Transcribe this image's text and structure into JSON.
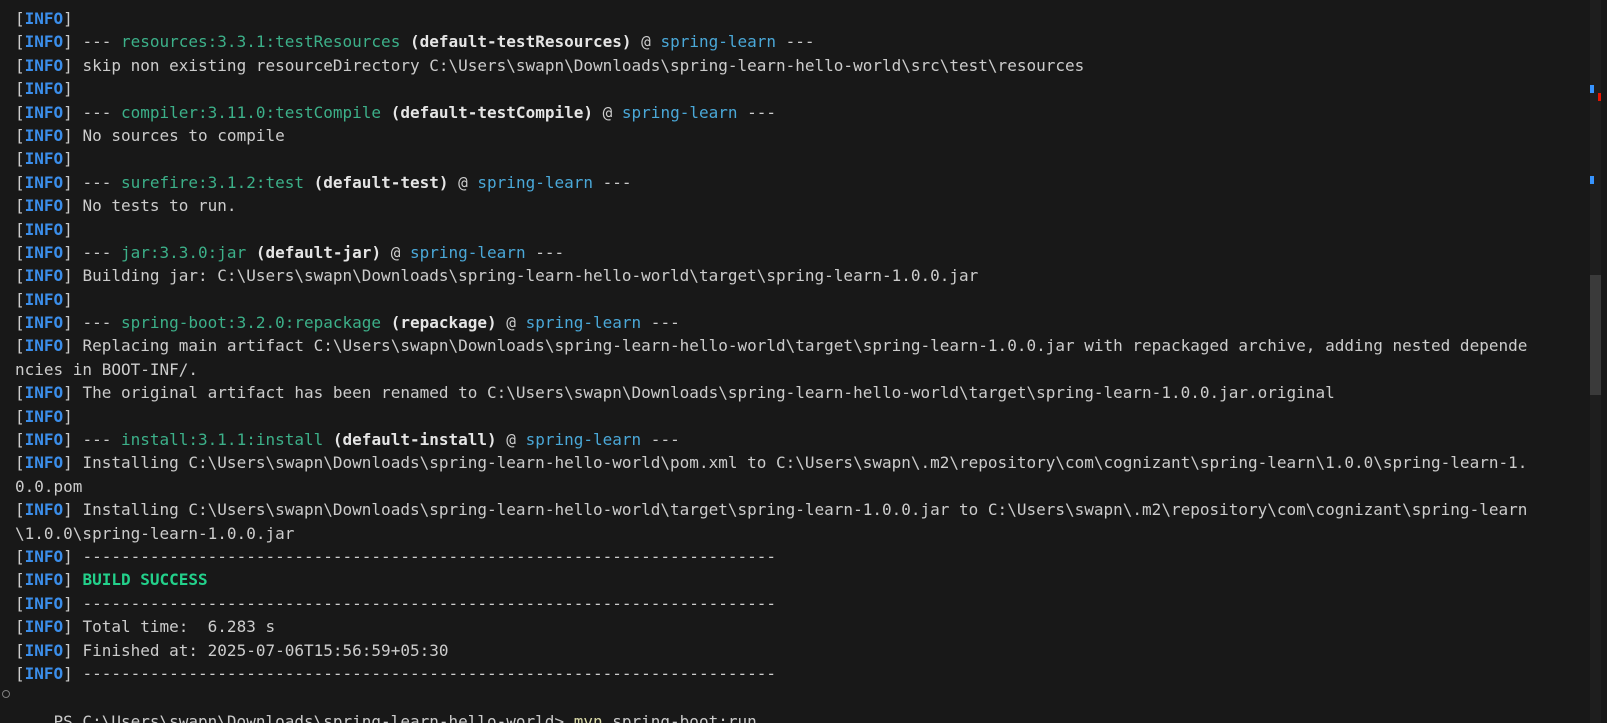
{
  "colors": {
    "background": "#181818",
    "text": "#cccccc",
    "info_tag": "#3b8eea",
    "success": "#23d18b",
    "plugin": "#3cb089",
    "project": "#4aa8d8",
    "command": "#dcdcaa"
  },
  "terminal": {
    "lines": [
      [
        {
          "c": "br",
          "t": "["
        },
        {
          "c": "tag",
          "t": "INFO"
        },
        {
          "c": "br",
          "t": "]"
        }
      ],
      [
        {
          "c": "br",
          "t": "["
        },
        {
          "c": "tag",
          "t": "INFO"
        },
        {
          "c": "br",
          "t": "] --- "
        },
        {
          "c": "plugin",
          "t": "resources:3.3.1:testResources"
        },
        {
          "c": "br",
          "t": " "
        },
        {
          "c": "bold",
          "t": "(default-testResources)"
        },
        {
          "c": "br",
          "t": " @ "
        },
        {
          "c": "proj",
          "t": "spring-learn"
        },
        {
          "c": "br",
          "t": " ---"
        }
      ],
      [
        {
          "c": "br",
          "t": "["
        },
        {
          "c": "tag",
          "t": "INFO"
        },
        {
          "c": "br",
          "t": "] skip non existing resourceDirectory C:\\Users\\swapn\\Downloads\\spring-learn-hello-world\\src\\test\\resources"
        }
      ],
      [
        {
          "c": "br",
          "t": "["
        },
        {
          "c": "tag",
          "t": "INFO"
        },
        {
          "c": "br",
          "t": "]"
        }
      ],
      [
        {
          "c": "br",
          "t": "["
        },
        {
          "c": "tag",
          "t": "INFO"
        },
        {
          "c": "br",
          "t": "] --- "
        },
        {
          "c": "plugin",
          "t": "compiler:3.11.0:testCompile"
        },
        {
          "c": "br",
          "t": " "
        },
        {
          "c": "bold",
          "t": "(default-testCompile)"
        },
        {
          "c": "br",
          "t": " @ "
        },
        {
          "c": "proj",
          "t": "spring-learn"
        },
        {
          "c": "br",
          "t": " ---"
        }
      ],
      [
        {
          "c": "br",
          "t": "["
        },
        {
          "c": "tag",
          "t": "INFO"
        },
        {
          "c": "br",
          "t": "] No sources to compile"
        }
      ],
      [
        {
          "c": "br",
          "t": "["
        },
        {
          "c": "tag",
          "t": "INFO"
        },
        {
          "c": "br",
          "t": "]"
        }
      ],
      [
        {
          "c": "br",
          "t": "["
        },
        {
          "c": "tag",
          "t": "INFO"
        },
        {
          "c": "br",
          "t": "] --- "
        },
        {
          "c": "plugin",
          "t": "surefire:3.1.2:test"
        },
        {
          "c": "br",
          "t": " "
        },
        {
          "c": "bold",
          "t": "(default-test)"
        },
        {
          "c": "br",
          "t": " @ "
        },
        {
          "c": "proj",
          "t": "spring-learn"
        },
        {
          "c": "br",
          "t": " ---"
        }
      ],
      [
        {
          "c": "br",
          "t": "["
        },
        {
          "c": "tag",
          "t": "INFO"
        },
        {
          "c": "br",
          "t": "] No tests to run."
        }
      ],
      [
        {
          "c": "br",
          "t": "["
        },
        {
          "c": "tag",
          "t": "INFO"
        },
        {
          "c": "br",
          "t": "]"
        }
      ],
      [
        {
          "c": "br",
          "t": "["
        },
        {
          "c": "tag",
          "t": "INFO"
        },
        {
          "c": "br",
          "t": "] --- "
        },
        {
          "c": "plugin",
          "t": "jar:3.3.0:jar"
        },
        {
          "c": "br",
          "t": " "
        },
        {
          "c": "bold",
          "t": "(default-jar)"
        },
        {
          "c": "br",
          "t": " @ "
        },
        {
          "c": "proj",
          "t": "spring-learn"
        },
        {
          "c": "br",
          "t": " ---"
        }
      ],
      [
        {
          "c": "br",
          "t": "["
        },
        {
          "c": "tag",
          "t": "INFO"
        },
        {
          "c": "br",
          "t": "] Building jar: C:\\Users\\swapn\\Downloads\\spring-learn-hello-world\\target\\spring-learn-1.0.0.jar"
        }
      ],
      [
        {
          "c": "br",
          "t": "["
        },
        {
          "c": "tag",
          "t": "INFO"
        },
        {
          "c": "br",
          "t": "]"
        }
      ],
      [
        {
          "c": "br",
          "t": "["
        },
        {
          "c": "tag",
          "t": "INFO"
        },
        {
          "c": "br",
          "t": "] --- "
        },
        {
          "c": "plugin",
          "t": "spring-boot:3.2.0:repackage"
        },
        {
          "c": "br",
          "t": " "
        },
        {
          "c": "bold",
          "t": "(repackage)"
        },
        {
          "c": "br",
          "t": " @ "
        },
        {
          "c": "proj",
          "t": "spring-learn"
        },
        {
          "c": "br",
          "t": " ---"
        }
      ],
      [
        {
          "c": "br",
          "t": "["
        },
        {
          "c": "tag",
          "t": "INFO"
        },
        {
          "c": "br",
          "t": "] Replacing main artifact C:\\Users\\swapn\\Downloads\\spring-learn-hello-world\\target\\spring-learn-1.0.0.jar with repackaged archive, adding nested depende"
        }
      ],
      [
        {
          "c": "br",
          "t": "ncies in BOOT-INF/."
        }
      ],
      [
        {
          "c": "br",
          "t": "["
        },
        {
          "c": "tag",
          "t": "INFO"
        },
        {
          "c": "br",
          "t": "] The original artifact has been renamed to C:\\Users\\swapn\\Downloads\\spring-learn-hello-world\\target\\spring-learn-1.0.0.jar.original"
        }
      ],
      [
        {
          "c": "br",
          "t": "["
        },
        {
          "c": "tag",
          "t": "INFO"
        },
        {
          "c": "br",
          "t": "]"
        }
      ],
      [
        {
          "c": "br",
          "t": "["
        },
        {
          "c": "tag",
          "t": "INFO"
        },
        {
          "c": "br",
          "t": "] --- "
        },
        {
          "c": "plugin",
          "t": "install:3.1.1:install"
        },
        {
          "c": "br",
          "t": " "
        },
        {
          "c": "bold",
          "t": "(default-install)"
        },
        {
          "c": "br",
          "t": " @ "
        },
        {
          "c": "proj",
          "t": "spring-learn"
        },
        {
          "c": "br",
          "t": " ---"
        }
      ],
      [
        {
          "c": "br",
          "t": "["
        },
        {
          "c": "tag",
          "t": "INFO"
        },
        {
          "c": "br",
          "t": "] Installing C:\\Users\\swapn\\Downloads\\spring-learn-hello-world\\pom.xml to C:\\Users\\swapn\\.m2\\repository\\com\\cognizant\\spring-learn\\1.0.0\\spring-learn-1."
        }
      ],
      [
        {
          "c": "br",
          "t": "0.0.pom"
        }
      ],
      [
        {
          "c": "br",
          "t": "["
        },
        {
          "c": "tag",
          "t": "INFO"
        },
        {
          "c": "br",
          "t": "] Installing C:\\Users\\swapn\\Downloads\\spring-learn-hello-world\\target\\spring-learn-1.0.0.jar to C:\\Users\\swapn\\.m2\\repository\\com\\cognizant\\spring-learn"
        }
      ],
      [
        {
          "c": "br",
          "t": "\\1.0.0\\spring-learn-1.0.0.jar"
        }
      ],
      [
        {
          "c": "br",
          "t": "["
        },
        {
          "c": "tag",
          "t": "INFO"
        },
        {
          "c": "br",
          "t": "] ------------------------------------------------------------------------"
        }
      ],
      [
        {
          "c": "br",
          "t": "["
        },
        {
          "c": "tag",
          "t": "INFO"
        },
        {
          "c": "br",
          "t": "] "
        },
        {
          "c": "green",
          "t": "BUILD SUCCESS"
        }
      ],
      [
        {
          "c": "br",
          "t": "["
        },
        {
          "c": "tag",
          "t": "INFO"
        },
        {
          "c": "br",
          "t": "] ------------------------------------------------------------------------"
        }
      ],
      [
        {
          "c": "br",
          "t": "["
        },
        {
          "c": "tag",
          "t": "INFO"
        },
        {
          "c": "br",
          "t": "] Total time:  6.283 s"
        }
      ],
      [
        {
          "c": "br",
          "t": "["
        },
        {
          "c": "tag",
          "t": "INFO"
        },
        {
          "c": "br",
          "t": "] Finished at: 2025-07-06T15:56:59+05:30"
        }
      ],
      [
        {
          "c": "br",
          "t": "["
        },
        {
          "c": "tag",
          "t": "INFO"
        },
        {
          "c": "br",
          "t": "] ------------------------------------------------------------------------"
        }
      ]
    ],
    "prompt": {
      "path": "PS C:\\Users\\swapn\\Downloads\\spring-learn-hello-world> ",
      "command_name": "mvn",
      "command_args": " spring-boot:run"
    }
  },
  "scrollbar": {
    "markers": [
      {
        "color": "#3794ff"
      },
      {
        "color": "#e51400"
      },
      {
        "color": "#3794ff"
      }
    ]
  }
}
